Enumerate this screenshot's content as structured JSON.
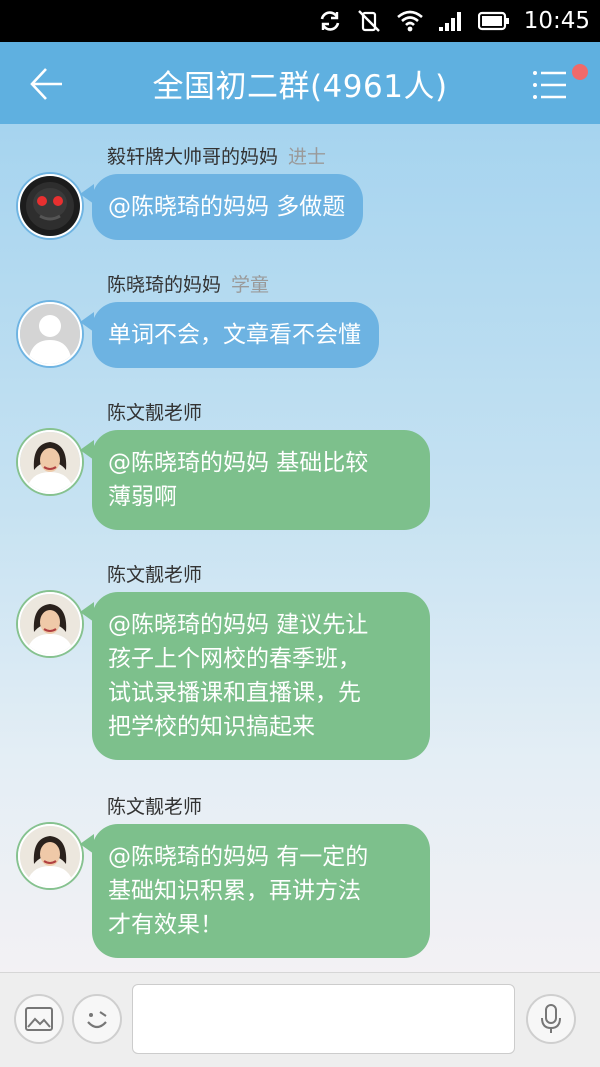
{
  "status_bar": {
    "time": "10:45",
    "icons": [
      "sync-icon",
      "mute-icon",
      "wifi-icon",
      "signal-icon",
      "battery-icon"
    ]
  },
  "header": {
    "title": "全国初二群(4961人)",
    "back_icon": "back-arrow-icon",
    "menu_icon": "menu-icon"
  },
  "messages": [
    {
      "sender": "毅轩牌大帅哥的妈妈",
      "rank": "进士",
      "text": "@陈晓琦的妈妈 多做题",
      "bubble_color": "#6db3e2",
      "avatar": "dark-skull-avatar"
    },
    {
      "sender": "陈晓琦的妈妈",
      "rank": "学童",
      "text": "单词不会，文章看不会懂",
      "bubble_color": "#6db3e2",
      "avatar": "default-user-avatar"
    },
    {
      "sender": "陈文靓老师",
      "rank": "",
      "text": "@陈晓琦的妈妈 基础比较\n薄弱啊",
      "bubble_color": "#7dc08c",
      "avatar": "teacher-avatar"
    },
    {
      "sender": "陈文靓老师",
      "rank": "",
      "text": "@陈晓琦的妈妈 建议先让\n孩子上个网校的春季班，\n试试录播课和直播课，先\n把学校的知识搞起来",
      "bubble_color": "#7dc08c",
      "avatar": "teacher-avatar"
    },
    {
      "sender": "陈文靓老师",
      "rank": "",
      "text": "@陈晓琦的妈妈 有一定的\n基础知识积累，再讲方法\n才有效果！",
      "bubble_color": "#7dc08c",
      "avatar": "teacher-avatar"
    }
  ],
  "input_bar": {
    "image_icon": "image-icon",
    "emoji_icon": "emoji-icon",
    "voice_icon": "microphone-icon",
    "input_value": "",
    "input_placeholder": ""
  },
  "colors": {
    "header": "#5fb0e0",
    "bubble_blue": "#6db3e2",
    "bubble_green": "#7dc08c",
    "notification_dot": "#f06a6a"
  }
}
